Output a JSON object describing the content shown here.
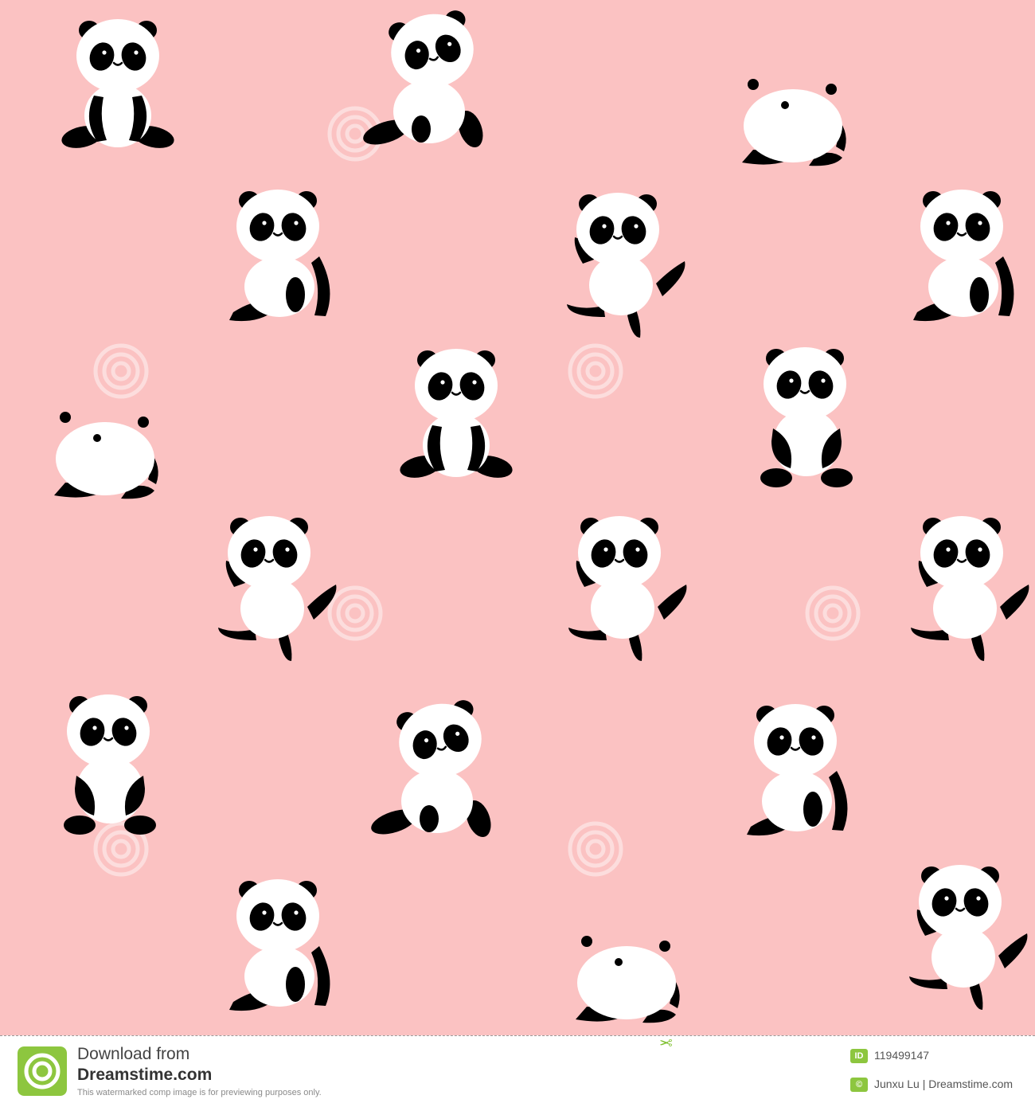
{
  "colors": {
    "background": "#fbc2c2",
    "panda_white": "#ffffff",
    "panda_black": "#000000",
    "brand_green": "#8dc63f"
  },
  "illustration": {
    "subject": "seamless pattern of cartoon baby pandas",
    "poses": [
      "sitting",
      "tilted-sitting",
      "lying",
      "leaning",
      "dancing",
      "back-view"
    ]
  },
  "footer": {
    "download_line": "Download from",
    "site_name": "Dreamstime.com",
    "preview_note": "This watermarked comp image is for previewing purposes only.",
    "id_badge": "ID",
    "image_id": "119499147",
    "copyright_icon": "copyright-icon",
    "author_credit": "Junxu Lu | Dreamstime.com"
  }
}
